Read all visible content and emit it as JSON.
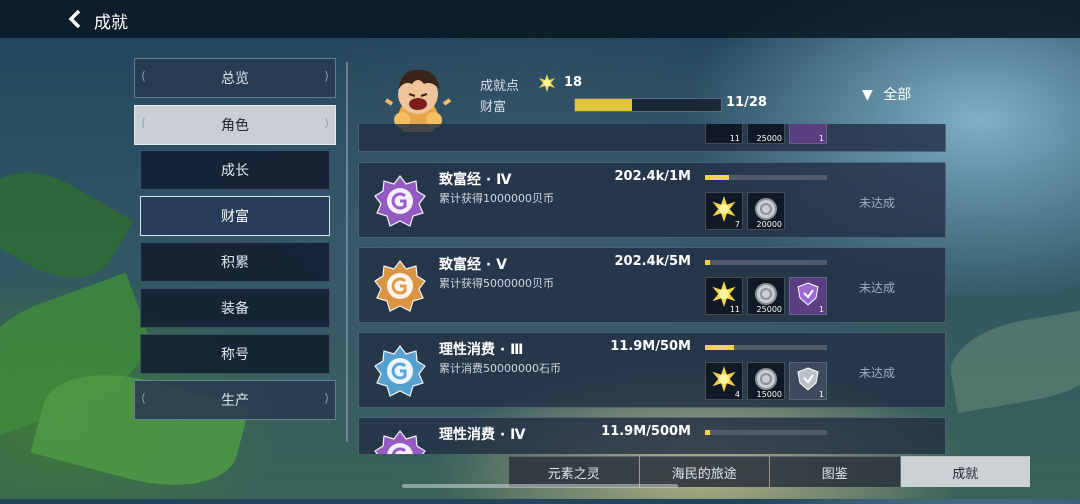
{
  "header": {
    "title": "成就"
  },
  "sidebar": {
    "items": [
      {
        "label": "总览",
        "level": 1,
        "active": false
      },
      {
        "label": "角色",
        "level": 1,
        "active": true
      },
      {
        "label": "成长",
        "level": 2,
        "active": false
      },
      {
        "label": "财富",
        "level": 2,
        "active": true
      },
      {
        "label": "积累",
        "level": 2,
        "active": false
      },
      {
        "label": "装备",
        "level": 2,
        "active": false
      },
      {
        "label": "称号",
        "level": 2,
        "active": false
      },
      {
        "label": "生产",
        "level": 1,
        "active": false
      }
    ]
  },
  "summary": {
    "points_label": "成就点",
    "points_value": "18",
    "category_label": "财富",
    "category_progress": "11/28",
    "category_fraction": 0.39,
    "filter_label": "全部"
  },
  "partial_top_row": {
    "reward_counts": [
      "11",
      "25000",
      "1"
    ]
  },
  "achievements": [
    {
      "name": "致富经 · Ⅳ",
      "desc": "累计获得1000000贝币",
      "progress": "202.4k/1M",
      "fraction": 0.2,
      "status": "未达成",
      "emblem": "purple",
      "rewards": [
        {
          "icon": "sun-icon",
          "count": "7"
        },
        {
          "icon": "silver-coin-icon",
          "count": "20000"
        }
      ]
    },
    {
      "name": "致富经 · Ⅴ",
      "desc": "累计获得5000000贝币",
      "progress": "202.4k/5M",
      "fraction": 0.04,
      "status": "未达成",
      "emblem": "orange",
      "rewards": [
        {
          "icon": "sun-icon",
          "count": "11"
        },
        {
          "icon": "silver-coin-icon",
          "count": "25000"
        },
        {
          "icon": "purple-shield-icon",
          "count": "1"
        }
      ]
    },
    {
      "name": "理性消费 · Ⅲ",
      "desc": "累计消费50000000石币",
      "progress": "11.9M/50M",
      "fraction": 0.24,
      "status": "未达成",
      "emblem": "blue",
      "rewards": [
        {
          "icon": "sun-icon",
          "count": "4"
        },
        {
          "icon": "silver-coin-icon",
          "count": "15000"
        },
        {
          "icon": "silver-shield-icon",
          "count": "1"
        }
      ]
    },
    {
      "name": "理性消费 · Ⅳ",
      "desc": "",
      "progress": "11.9M/500M",
      "fraction": 0.024,
      "status": "",
      "emblem": "purple",
      "rewards": []
    }
  ],
  "tabs": [
    {
      "label": "元素之灵",
      "active": false
    },
    {
      "label": "海民的旅途",
      "active": false
    },
    {
      "label": "图鉴",
      "active": false
    },
    {
      "label": "成就",
      "active": true
    }
  ],
  "colors": {
    "accent": "#f2d64a",
    "purple": "#9a5cc8",
    "orange": "#e39a45",
    "blue": "#5aa7d6"
  }
}
